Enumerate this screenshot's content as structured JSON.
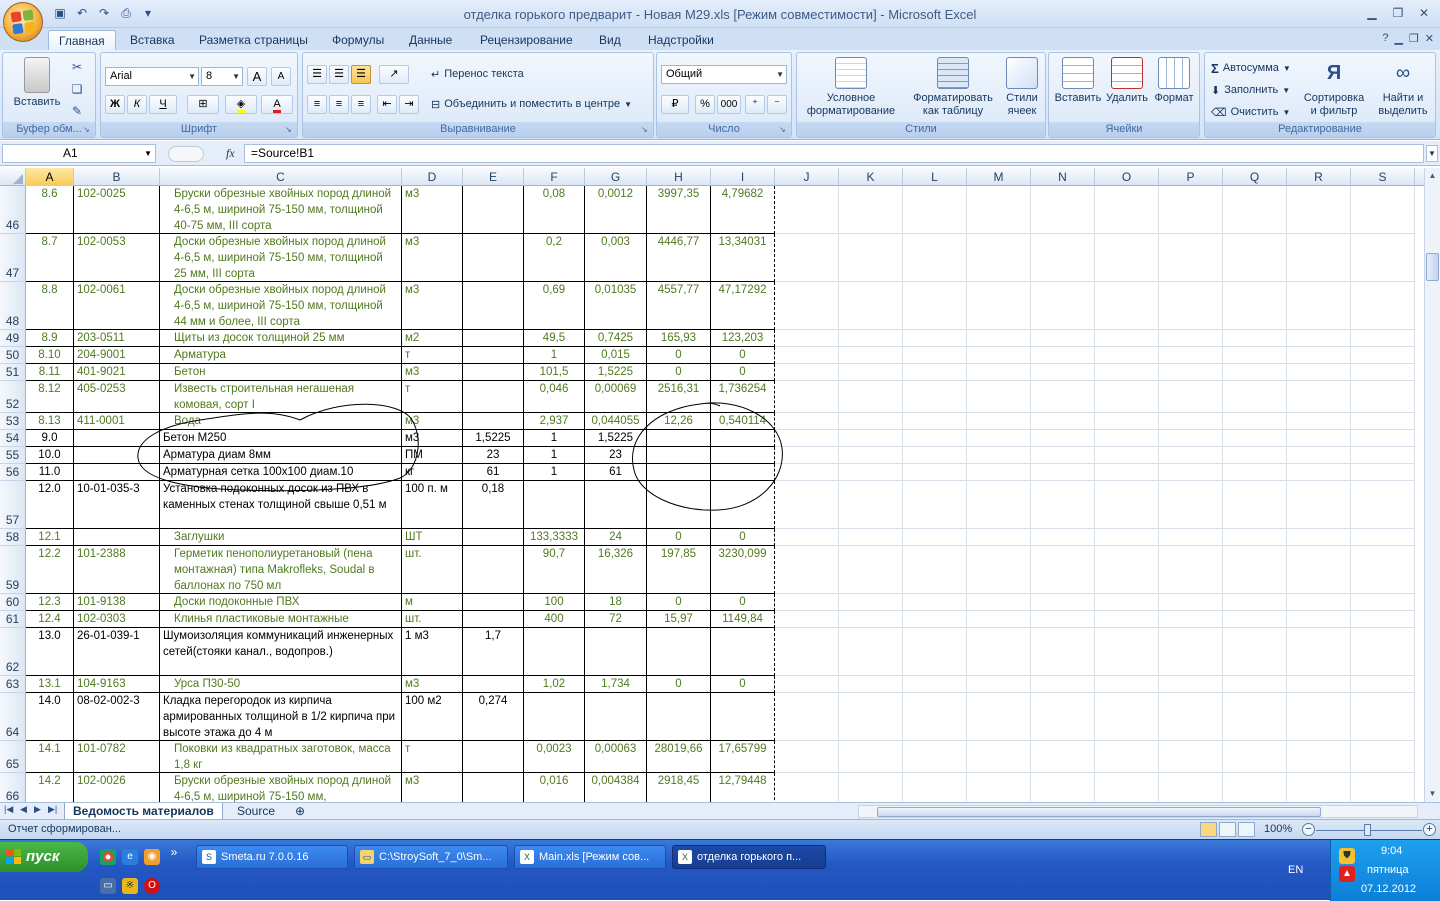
{
  "window": {
    "title": "отделка горького предварит - Новая М29.xls  [Режим совместимости] - Microsoft Excel"
  },
  "ribbon_tabs": [
    "Главная",
    "Вставка",
    "Разметка страницы",
    "Формулы",
    "Данные",
    "Рецензирование",
    "Вид",
    "Надстройки"
  ],
  "ribbon": {
    "clipboard": {
      "label": "Буфер обм...",
      "paste": "Вставить"
    },
    "font": {
      "label": "Шрифт",
      "name": "Arial",
      "size": "8",
      "bold": "Ж",
      "italic": "К",
      "underline": "Ч",
      "grow": "A",
      "shrink": "A",
      "color": "A"
    },
    "alignment": {
      "label": "Выравнивание",
      "wrap": "Перенос текста",
      "merge": "Объединить и поместить в центре"
    },
    "number": {
      "label": "Число",
      "format": "Общий",
      "percent": "%",
      "thousands": "000"
    },
    "styles": {
      "label": "Стили",
      "conditional_1": "Условное",
      "conditional_2": "форматирование",
      "astable_1": "Форматировать",
      "astable_2": "как таблицу",
      "cellstyles_1": "Стили",
      "cellstyles_2": "ячеек"
    },
    "cells": {
      "label": "Ячейки",
      "insert": "Вставить",
      "delete": "Удалить",
      "format": "Формат"
    },
    "editing": {
      "label": "Редактирование",
      "autosum": "Автосумма",
      "fill": "Заполнить",
      "clear": "Очистить",
      "sort_1": "Сортировка",
      "sort_2": "и фильтр",
      "find_1": "Найти и",
      "find_2": "выделить",
      "sigma": "Σ"
    }
  },
  "formula_bar": {
    "name_box": "A1",
    "fx": "fx",
    "formula": "=Source!B1"
  },
  "columns": [
    "A",
    "B",
    "C",
    "D",
    "E",
    "F",
    "G",
    "H",
    "I",
    "J",
    "K",
    "L",
    "M",
    "N",
    "O",
    "P",
    "Q",
    "R",
    "S"
  ],
  "rows": [
    {
      "n": "46",
      "a": "8.6",
      "b": "102-0025",
      "c": "Бруски обрезные хвойных пород длиной 4-6,5 м, шириной 75-150 мм, толщиной 40-75 мм, III сорта",
      "d": "м3",
      "e": "",
      "f": "0,08",
      "g": "0,0012",
      "h": "3997,35",
      "i": "4,79682",
      "color": "g"
    },
    {
      "n": "47",
      "a": "8.7",
      "b": "102-0053",
      "c": "Доски обрезные хвойных пород длиной 4-6,5 м, шириной 75-150 мм, толщиной 25 мм, III сорта",
      "d": "м3",
      "e": "",
      "f": "0,2",
      "g": "0,003",
      "h": "4446,77",
      "i": "13,34031",
      "color": "g"
    },
    {
      "n": "48",
      "a": "8.8",
      "b": "102-0061",
      "c": "Доски обрезные хвойных пород длиной 4-6,5 м, шириной 75-150 мм, толщиной 44 мм и более, III сорта",
      "d": "м3",
      "e": "",
      "f": "0,69",
      "g": "0,01035",
      "h": "4557,77",
      "i": "47,17292",
      "color": "g"
    },
    {
      "n": "49",
      "a": "8.9",
      "b": "203-0511",
      "c": "Щиты из досок толщиной 25 мм",
      "d": "м2",
      "e": "",
      "f": "49,5",
      "g": "0,7425",
      "h": "165,93",
      "i": "123,203",
      "color": "g"
    },
    {
      "n": "50",
      "a": "8.10",
      "b": "204-9001",
      "c": "Арматура",
      "d": "т",
      "e": "",
      "f": "1",
      "g": "0,015",
      "h": "0",
      "i": "0",
      "color": "g"
    },
    {
      "n": "51",
      "a": "8.11",
      "b": "401-9021",
      "c": "Бетон",
      "d": "м3",
      "e": "",
      "f": "101,5",
      "g": "1,5225",
      "h": "0",
      "i": "0",
      "color": "g"
    },
    {
      "n": "52",
      "a": "8.12",
      "b": "405-0253",
      "c": "Известь строительная негашеная комовая, сорт I",
      "d": "т",
      "e": "",
      "f": "0,046",
      "g": "0,00069",
      "h": "2516,31",
      "i": "1,736254",
      "color": "g"
    },
    {
      "n": "53",
      "a": "8.13",
      "b": "411-0001",
      "c": "Вода",
      "d": "м3",
      "e": "",
      "f": "2,937",
      "g": "0,044055",
      "h": "12,26",
      "i": "0,540114",
      "color": "g"
    },
    {
      "n": "54",
      "a": "9.0",
      "b": "",
      "c": "Бетон М250",
      "d": "м3",
      "e": "1,5225",
      "f": "1",
      "g": "1,5225",
      "h": "",
      "i": "",
      "color": "k"
    },
    {
      "n": "55",
      "a": "10.0",
      "b": "",
      "c": "Арматура диам 8мм",
      "d": "ПМ",
      "e": "23",
      "f": "1",
      "g": "23",
      "h": "",
      "i": "",
      "color": "k"
    },
    {
      "n": "56",
      "a": "11.0",
      "b": "",
      "c": "Арматурная сетка 100х100 диам.10",
      "d": "кг",
      "e": "61",
      "f": "1",
      "g": "61",
      "h": "",
      "i": "",
      "color": "k"
    },
    {
      "n": "57",
      "a": "12.0",
      "b": "10-01-035-3",
      "c": "Установка подоконных досок из ПВХ в каменных стенах толщиной свыше 0,51 м",
      "d": "100 п. м",
      "e": "0,18",
      "f": "",
      "g": "",
      "h": "",
      "i": "",
      "color": "k"
    },
    {
      "n": "58",
      "a": "12.1",
      "b": "",
      "c": "Заглушки",
      "d": "ШТ",
      "e": "",
      "f": "133,3333",
      "g": "24",
      "h": "0",
      "i": "0",
      "color": "g"
    },
    {
      "n": "59",
      "a": "12.2",
      "b": "101-2388",
      "c": "Герметик пенополиуретановый (пена монтажная) типа Makroflеks, Soudal в баллонах по 750 мл",
      "d": "шт.",
      "e": "",
      "f": "90,7",
      "g": "16,326",
      "h": "197,85",
      "i": "3230,099",
      "color": "g"
    },
    {
      "n": "60",
      "a": "12.3",
      "b": "101-9138",
      "c": "Доски подоконные ПВХ",
      "d": "м",
      "e": "",
      "f": "100",
      "g": "18",
      "h": "0",
      "i": "0",
      "color": "g"
    },
    {
      "n": "61",
      "a": "12.4",
      "b": "102-0303",
      "c": "Клинья пластиковые монтажные",
      "d": "шт.",
      "e": "",
      "f": "400",
      "g": "72",
      "h": "15,97",
      "i": "1149,84",
      "color": "g"
    },
    {
      "n": "62",
      "a": "13.0",
      "b": "26-01-039-1",
      "c": "Шумоизоляция коммуникаций инженерных сетей(стояки канал., водопров.)",
      "d": "1 м3",
      "e": "1,7",
      "f": "",
      "g": "",
      "h": "",
      "i": "",
      "color": "k"
    },
    {
      "n": "63",
      "a": "13.1",
      "b": "104-9163",
      "c": "Урса П30-50",
      "d": "м3",
      "e": "",
      "f": "1,02",
      "g": "1,734",
      "h": "0",
      "i": "0",
      "color": "g"
    },
    {
      "n": "64",
      "a": "14.0",
      "b": "08-02-002-3",
      "c": "Кладка перегородок из кирпича армированных толщиной в 1/2 кирпича при высоте этажа до 4 м",
      "d": "100 м2",
      "e": "0,274",
      "f": "",
      "g": "",
      "h": "",
      "i": "",
      "color": "k"
    },
    {
      "n": "65",
      "a": "14.1",
      "b": "101-0782",
      "c": "Поковки из квадратных заготовок, масса 1,8 кг",
      "d": "т",
      "e": "",
      "f": "0,0023",
      "g": "0,00063",
      "h": "28019,66",
      "i": "17,65799",
      "color": "g"
    },
    {
      "n": "66",
      "a": "14.2",
      "b": "102-0026",
      "c": "Бруски обрезные хвойных пород длиной 4-6,5 м, шириной 75-150 мм,",
      "d": "м3",
      "e": "",
      "f": "0,016",
      "g": "0,004384",
      "h": "2918,45",
      "i": "12,79448",
      "color": "g"
    }
  ],
  "sheets": {
    "active": "Ведомость материалов",
    "other": "Source"
  },
  "status": {
    "message": "Отчет сформирован...",
    "zoom": "100%"
  },
  "taskbar": {
    "start": "пуск",
    "buttons": [
      "Smeta.ru  7.0.0.16",
      "C:\\StroySoft_7_0\\Sm...",
      "Main.xls  [Режим сов...",
      "отделка горького п..."
    ],
    "lang": "EN",
    "time": "9:04",
    "day": "пятница",
    "date": "07.12.2012"
  }
}
